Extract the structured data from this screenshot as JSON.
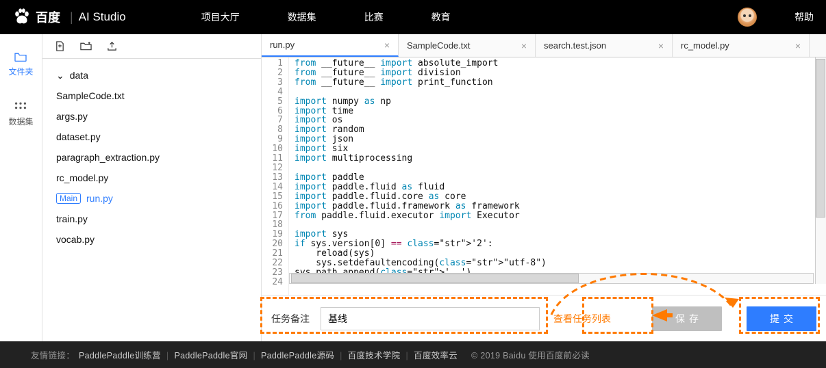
{
  "header": {
    "brand_cn": "百度",
    "brand_studio": "AI Studio",
    "nav": [
      "项目大厅",
      "数据集",
      "比赛",
      "教育"
    ],
    "help": "帮助"
  },
  "sidebar": {
    "items": [
      {
        "label": "文件夹",
        "icon": "folder"
      },
      {
        "label": "数据集",
        "icon": "dataset"
      }
    ]
  },
  "files": {
    "folder": "data",
    "main_badge": "Main",
    "list": [
      "SampleCode.txt",
      "args.py",
      "dataset.py",
      "paragraph_extraction.py",
      "rc_model.py",
      "run.py",
      "train.py",
      "vocab.py"
    ],
    "active": "run.py"
  },
  "tabs": [
    {
      "label": "run.py",
      "active": true
    },
    {
      "label": "SampleCode.txt",
      "active": false
    },
    {
      "label": "search.test.json",
      "active": false
    },
    {
      "label": "rc_model.py",
      "active": false
    }
  ],
  "code": {
    "lines": [
      {
        "n": 1,
        "t": "from __future__ import absolute_import"
      },
      {
        "n": 2,
        "t": "from __future__ import division"
      },
      {
        "n": 3,
        "t": "from __future__ import print_function"
      },
      {
        "n": 4,
        "t": ""
      },
      {
        "n": 5,
        "t": "import numpy as np"
      },
      {
        "n": 6,
        "t": "import time"
      },
      {
        "n": 7,
        "t": "import os"
      },
      {
        "n": 8,
        "t": "import random"
      },
      {
        "n": 9,
        "t": "import json"
      },
      {
        "n": 10,
        "t": "import six"
      },
      {
        "n": 11,
        "t": "import multiprocessing"
      },
      {
        "n": 12,
        "t": ""
      },
      {
        "n": 13,
        "t": "import paddle"
      },
      {
        "n": 14,
        "t": "import paddle.fluid as fluid"
      },
      {
        "n": 15,
        "t": "import paddle.fluid.core as core"
      },
      {
        "n": 16,
        "t": "import paddle.fluid.framework as framework"
      },
      {
        "n": 17,
        "t": "from paddle.fluid.executor import Executor"
      },
      {
        "n": 18,
        "t": ""
      },
      {
        "n": 19,
        "t": "import sys"
      },
      {
        "n": 20,
        "t": "if sys.version[0] == '2':"
      },
      {
        "n": 21,
        "t": "    reload(sys)"
      },
      {
        "n": 22,
        "t": "    sys.setdefaultencoding(\"utf-8\")"
      },
      {
        "n": 23,
        "t": "sys.path.append('..')"
      },
      {
        "n": 24,
        "t": ""
      }
    ]
  },
  "task": {
    "label": "任务备注",
    "value": "基线",
    "view_list": "查看任务列表",
    "save": "保存",
    "submit": "提交"
  },
  "footer": {
    "label": "友情链接：",
    "links": [
      "PaddlePaddle训练营",
      "PaddlePaddle官网",
      "PaddlePaddle源码",
      "百度技术学院",
      "百度效率云"
    ],
    "copy": "© 2019 Baidu 使用百度前必读"
  },
  "colors": {
    "accent": "#2e7dff",
    "highlight": "#ff7a00"
  }
}
